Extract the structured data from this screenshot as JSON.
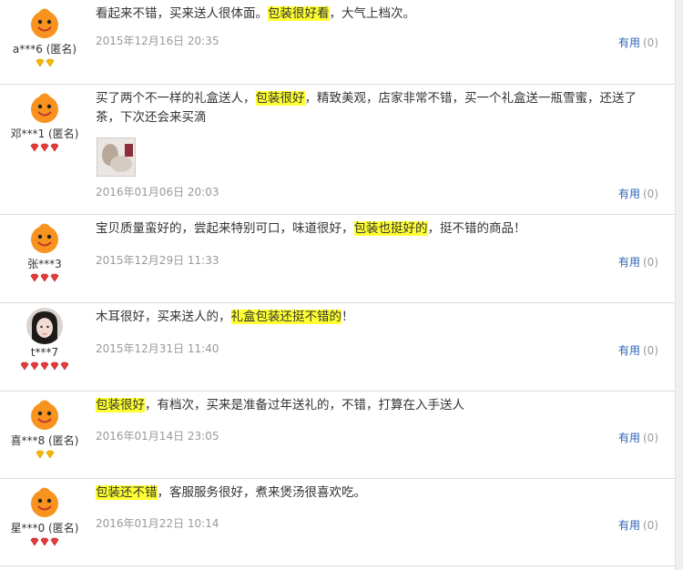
{
  "reviews": [
    {
      "user": "a***6 (匿名)",
      "avatar": "orange-mascot-avatar",
      "level": "gold",
      "gem_count": 2,
      "text_before": "看起来不错，买来送人很体面。",
      "highlight": "包装很好看",
      "text_after": "，大气上档次。",
      "date": "2015年12月16日 20:35",
      "useful_label": "有用",
      "useful_count": "(0)",
      "has_image": false
    },
    {
      "user": "邓***1 (匿名)",
      "avatar": "orange-mascot-avatar",
      "level": "red",
      "gem_count": 3,
      "text_before": "买了两个不一样的礼盒送人，",
      "highlight": "包装很好",
      "text_after": "，精致美观，店家非常不错，买一个礼盒送一瓶雪蜜，还送了茶，下次还会来买滴",
      "date": "2016年01月06日 20:03",
      "useful_label": "有用",
      "useful_count": "(0)",
      "has_image": true
    },
    {
      "user": "张***3",
      "avatar": "orange-mascot-avatar",
      "level": "red",
      "gem_count": 3,
      "text_before": "宝贝质量蛮好的，尝起来特别可口，味道很好，",
      "highlight": "包装也挺好的",
      "text_after": "，挺不错的商品！",
      "date": "2015年12月29日 11:33",
      "useful_label": "有用",
      "useful_count": "(0)",
      "has_image": false
    },
    {
      "user": "t***7",
      "avatar": "photo-avatar",
      "level": "red",
      "gem_count": 5,
      "text_before": "木耳很好，买来送人的，",
      "highlight": "礼盒包装还挺不错的",
      "text_after": "！",
      "date": "2015年12月31日 11:40",
      "useful_label": "有用",
      "useful_count": "(0)",
      "has_image": false
    },
    {
      "user": "喜***8 (匿名)",
      "avatar": "orange-mascot-avatar",
      "level": "gold",
      "gem_count": 2,
      "text_before": "",
      "highlight": "包装很好",
      "text_after": "，有档次，买来是准备过年送礼的，不错，打算在入手送人",
      "date": "2016年01月14日 23:05",
      "useful_label": "有用",
      "useful_count": "(0)",
      "has_image": false
    },
    {
      "user": "星***0 (匿名)",
      "avatar": "orange-mascot-avatar",
      "level": "red",
      "gem_count": 3,
      "text_before": "",
      "highlight": "包装还不错",
      "text_after": "，客服服务很好，煮来煲汤很喜欢吃。",
      "date": "2016年01月22日 10:14",
      "useful_label": "有用",
      "useful_count": "(0)",
      "has_image": false
    }
  ],
  "colors": {
    "highlight": "#ffff33",
    "useful_link": "#2b63b5",
    "date": "#999999",
    "gold_gem": "#f5b800",
    "red_gem": "#e53b3b",
    "mascot_orange": "#f7931e"
  }
}
